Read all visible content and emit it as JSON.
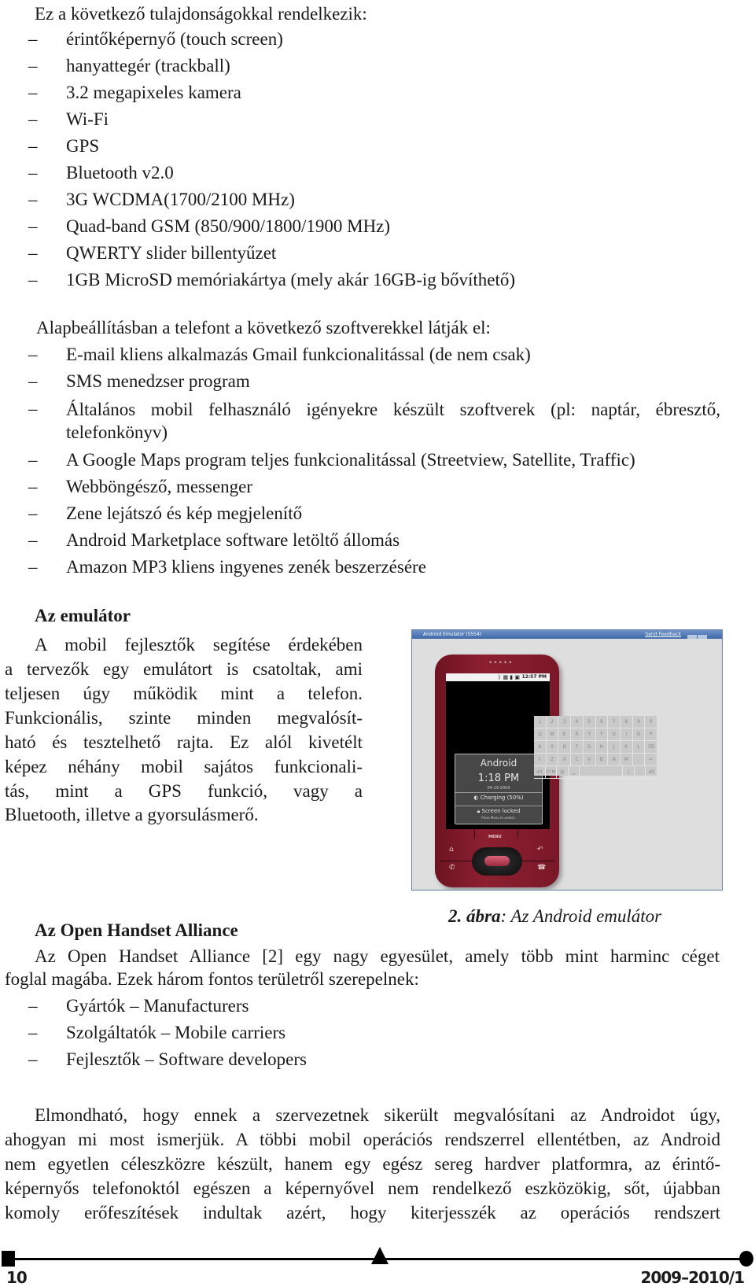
{
  "intro": "Ez a következő tulajdonságokkal rendelkezik:",
  "features": [
    "érintőképernyő (touch screen)",
    "hanyattegér (trackball)",
    "3.2 megapixeles kamera",
    "Wi-Fi",
    "GPS",
    "Bluetooth v2.0",
    "3G WCDMA(1700/2100 MHz)",
    "Quad-band GSM (850/900/1800/1900 MHz)",
    "QWERTY slider billentyűzet",
    "1GB MicroSD memóriakártya (mely akár 16GB-ig bővíthető)"
  ],
  "software_intro": "Alapbeállításban a telefont a következő szoftverekkel látják el:",
  "software": [
    "E-mail kliens alkalmazás Gmail funkcionalitással (de nem csak)",
    "SMS menedzser program",
    "Általános mobil felhasználó igényekre készült szoftverek (pl: naptár, ébresztő,",
    "telefonkönyv)",
    "A Google Maps program teljes funkcionalitással (Streetview, Satellite, Traffic)",
    "Webböngésző, messenger",
    "Zene lejátszó és kép megjelenítő",
    "Android Marketplace software letöltő állomás",
    "Amazon MP3 kliens ingyenes zenék beszerzésére"
  ],
  "emulator_section": {
    "heading": "Az emulátor",
    "lines": [
      "A mobil fejlesztők segítése érdekében",
      "a tervezők egy emulátort is csatoltak, ami",
      "teljesen úgy működik mint a telefon.",
      "Funkcionális, szinte minden megvalósít-",
      "ható és tesztelhető rajta. Ez alól kivetélt",
      "képez néhány mobil sajátos funkcionali-",
      "tás, mint a GPS funkció, vagy a",
      "Bluetooth, illetve a gyorsulásmerő."
    ]
  },
  "figure": {
    "window_title": "Android Emulator (5554)",
    "window_link": "Send Feedback",
    "status_time": "12:57 PM",
    "status_icons": "ᛒ ▦ ▮ ▣",
    "speaker": "•••••",
    "carrier": "Android",
    "lock_time": "1:18 PM",
    "lock_date": "04-19-2009",
    "charging": "Charging (50%)",
    "screen_locked": "Screen locked",
    "unlock_hint": "Press Menu to unlock.",
    "menu_label": "MENU",
    "keyboard_rows": [
      [
        "1",
        "2",
        "3",
        "4",
        "5",
        "6",
        "7",
        "8",
        "9",
        "0"
      ],
      [
        "Q",
        "W",
        "E",
        "R",
        "T",
        "Y",
        "U",
        "I",
        "O",
        "P"
      ],
      [
        "A",
        "S",
        "D",
        "F",
        "G",
        "H",
        "J",
        "K",
        "L",
        "⌫"
      ],
      [
        "⇧",
        "Z",
        "X",
        "C",
        "V",
        "B",
        "N",
        "M",
        ".",
        "↵"
      ],
      [
        "alt",
        "SYM",
        "@",
        "␣",
        "",
        "/",
        ",",
        "alt"
      ]
    ],
    "caption_number": "2. ábra",
    "caption_text": ": Az Android emulátor"
  },
  "oha_section": {
    "heading": "Az Open Handset Alliance",
    "line1": "Az Open Handset Alliance [2] egy nagy egyesület, amely több mint harminc céget",
    "line2": "foglal magába. Ezek három fontos területről szerepelnek:",
    "items": [
      "Gyártók – Manufacturers",
      "Szolgáltatók – Mobile carriers",
      "Fejlesztők – Software developers"
    ]
  },
  "closing_paragraph": [
    "Elmondható, hogy ennek a szervezetnek sikerült megvalósítani az Androidot úgy,",
    "ahogyan mi most ismerjük. A többi mobil operációs rendszerrel ellentétben, az Android",
    "nem egyetlen céleszközre készült, hanem egy egész sereg hardver platformra, az érintő-",
    "képernyős telefonoktól egészen a képernyővel nem rendelkező eszközökig, sőt, újabban",
    "komoly erőfeszítések indultak azért, hogy kiterjesszék az operációs rendszert"
  ],
  "dash": "–",
  "footer": {
    "page_number": "10",
    "issue": "2009–2010/1"
  }
}
